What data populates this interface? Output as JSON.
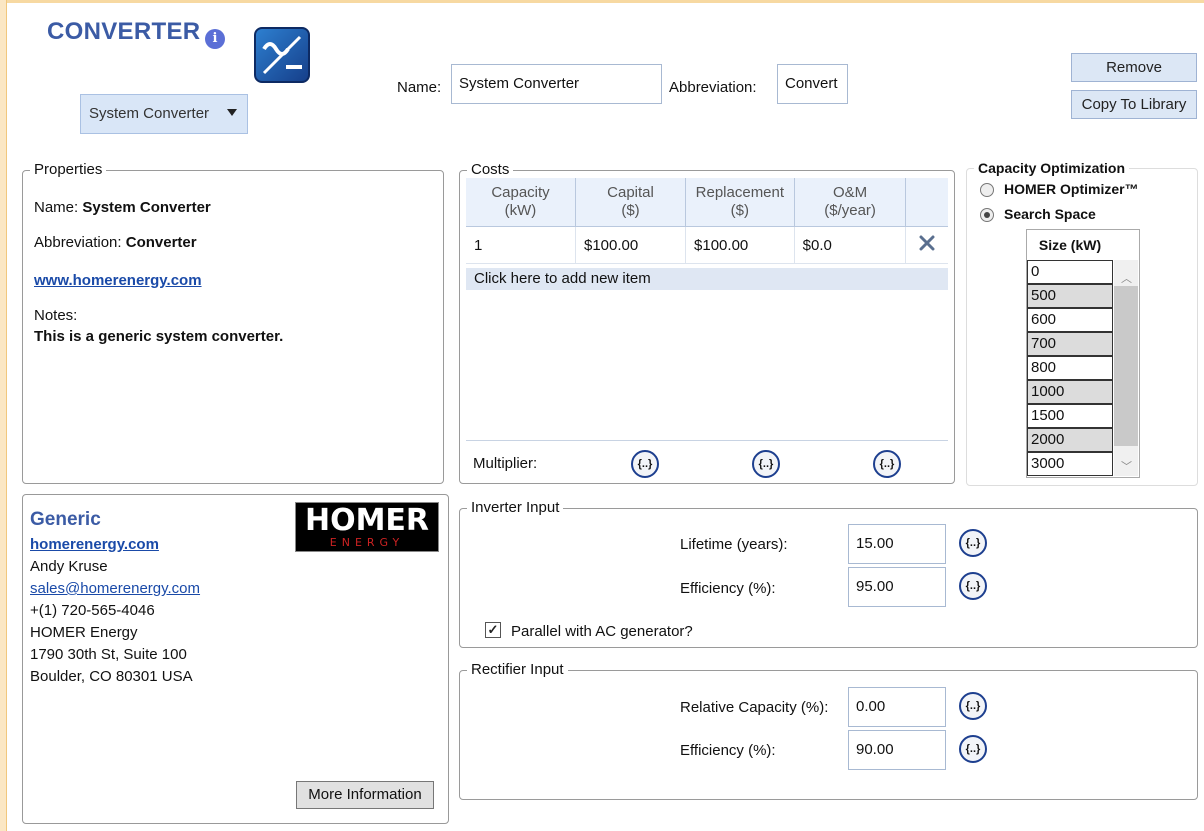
{
  "header": {
    "title": "CONVERTER",
    "info_glyph": "i",
    "type_dropdown": "System Converter",
    "name_label": "Name:",
    "name_value": "System Converter",
    "abbreviation_label": "Abbreviation:",
    "abbreviation_value": "Convert",
    "remove_label": "Remove",
    "copy_label": "Copy To Library"
  },
  "properties": {
    "legend": "Properties",
    "name_label": "Name:",
    "name_value": "System Converter",
    "abbreviation_label": "Abbreviation:",
    "abbreviation_value": "Converter",
    "website": "www.homerenergy.com",
    "notes_label": "Notes:",
    "notes_value": "This is a generic system converter."
  },
  "costs": {
    "legend": "Costs",
    "columns": [
      {
        "line1": "Capacity",
        "line2": "(kW)"
      },
      {
        "line1": "Capital",
        "line2": "($)"
      },
      {
        "line1": "Replacement",
        "line2": "($)"
      },
      {
        "line1": "O&M",
        "line2": "($/year)"
      }
    ],
    "rows": [
      {
        "capacity": "1",
        "capital": "$100.00",
        "replacement": "$100.00",
        "om": "$0.0"
      }
    ],
    "add_item": "Click here to add new item",
    "multiplier_label": "Multiplier:",
    "multiplier_glyph": "{..}"
  },
  "optimization": {
    "legend": "Capacity Optimization",
    "option1": "HOMER Optimizer™",
    "option2": "Search Space",
    "selected": "Search Space",
    "size_header": "Size (kW)",
    "sizes": [
      "0",
      "500",
      "600",
      "700",
      "800",
      "1000",
      "1500",
      "2000",
      "3000"
    ]
  },
  "manufacturer": {
    "name": "Generic",
    "website": "homerenergy.com",
    "contact": "Andy Kruse",
    "email": "sales@homerenergy.com",
    "phone": "+(1) 720-565-4046",
    "company": "HOMER Energy",
    "address1": "1790 30th St, Suite 100",
    "address2": "Boulder, CO 80301 USA",
    "logo_text": "HOMER",
    "logo_sub": "ENERGY",
    "more_info": "More Information"
  },
  "inverter": {
    "legend": "Inverter Input",
    "lifetime_label": "Lifetime (years):",
    "lifetime_value": "15.00",
    "efficiency_label": "Efficiency (%):",
    "efficiency_value": "95.00",
    "parallel_label": "Parallel with AC generator?",
    "parallel_checked": true,
    "sensitivity_glyph": "{..}"
  },
  "rectifier": {
    "legend": "Rectifier Input",
    "capacity_label": "Relative Capacity (%):",
    "capacity_value": "0.00",
    "efficiency_label": "Efficiency (%):",
    "efficiency_value": "90.00",
    "sensitivity_glyph": "{..}"
  },
  "colors": {
    "title": "#3b5ba5",
    "link": "#1a4aa8",
    "button_bg": "#dce7f5"
  }
}
